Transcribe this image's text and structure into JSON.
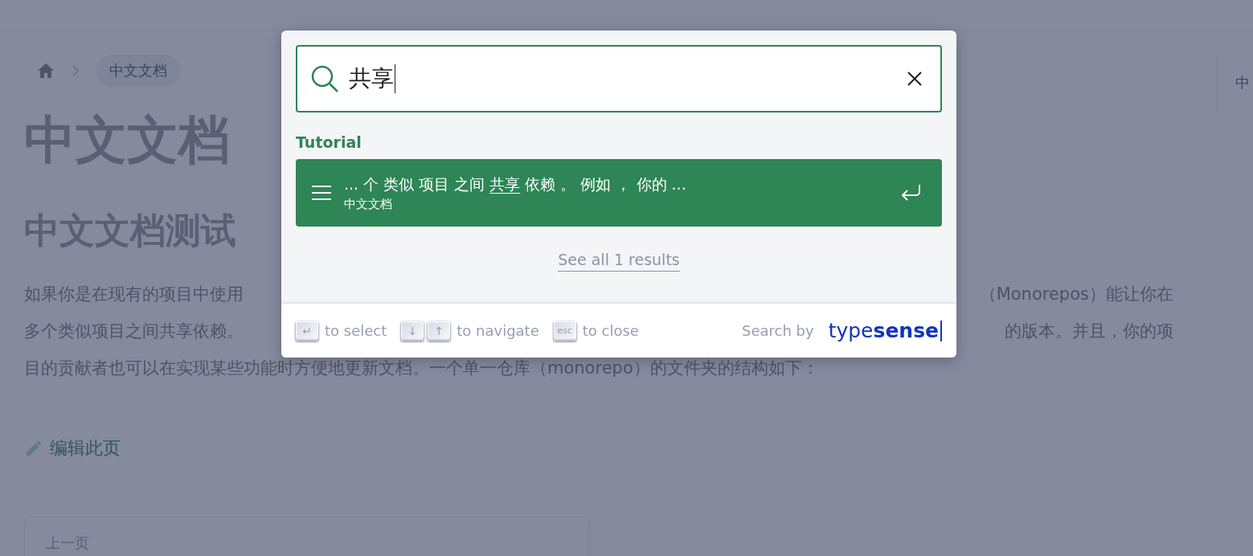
{
  "breadcrumb": {
    "current": "中文文档"
  },
  "title": "中文文档",
  "subtitle": "中文文档测试",
  "paragraph_lines": [
    {
      "left": "如果你是在现有的项目中使用",
      "right": "（Monorepos）能让你在"
    },
    {
      "left": "多个类似项目之间共享依赖。",
      "right": "的版本。并且，你的项"
    },
    {
      "left": "目的贡献者也可以在实现某些功能时方便地更新文档。一个单一仓库（monorepo）的文件夹的结构如下："
    }
  ],
  "edit_link": "编辑此页",
  "pager": {
    "label": "上一页"
  },
  "toc": {
    "text": "中"
  },
  "search_modal": {
    "query": "共享",
    "section": "Tutorial",
    "results": [
      {
        "title_before": "... 个 类似 项目 之间 ",
        "title_match": "共享",
        "title_after": " 依赖 。 例如 ， 你的 ...",
        "path": "中文文档",
        "selected": true
      }
    ],
    "see_all": "See all 1 results",
    "footer": [
      {
        "keys": [
          "↵"
        ],
        "label": "to select"
      },
      {
        "keys": [
          "↓",
          "↑"
        ],
        "label": "to navigate"
      },
      {
        "keys": [
          "esc"
        ],
        "label": "to close"
      }
    ],
    "search_by": "Search by",
    "logo_light": "type",
    "logo_bold": "sense"
  }
}
